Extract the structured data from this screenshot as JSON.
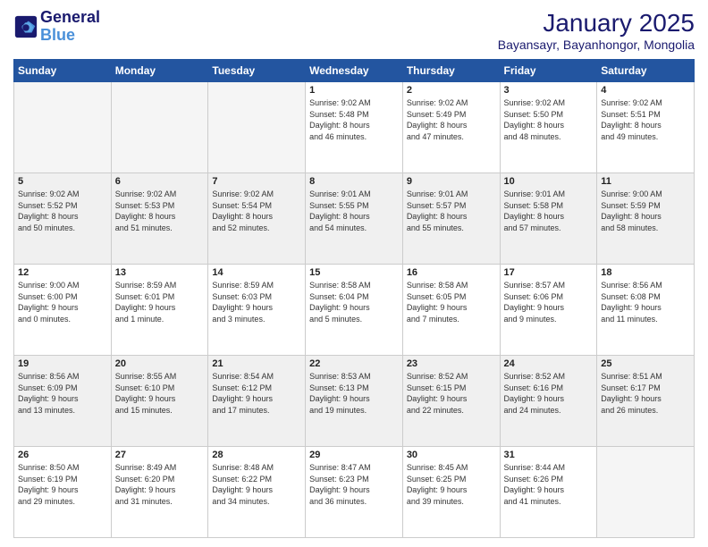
{
  "header": {
    "logo_line1": "General",
    "logo_line2": "Blue",
    "month": "January 2025",
    "location": "Bayansayr, Bayanhongor, Mongolia"
  },
  "weekdays": [
    "Sunday",
    "Monday",
    "Tuesday",
    "Wednesday",
    "Thursday",
    "Friday",
    "Saturday"
  ],
  "weeks": [
    [
      {
        "day": "",
        "info": ""
      },
      {
        "day": "",
        "info": ""
      },
      {
        "day": "",
        "info": ""
      },
      {
        "day": "1",
        "info": "Sunrise: 9:02 AM\nSunset: 5:48 PM\nDaylight: 8 hours\nand 46 minutes."
      },
      {
        "day": "2",
        "info": "Sunrise: 9:02 AM\nSunset: 5:49 PM\nDaylight: 8 hours\nand 47 minutes."
      },
      {
        "day": "3",
        "info": "Sunrise: 9:02 AM\nSunset: 5:50 PM\nDaylight: 8 hours\nand 48 minutes."
      },
      {
        "day": "4",
        "info": "Sunrise: 9:02 AM\nSunset: 5:51 PM\nDaylight: 8 hours\nand 49 minutes."
      }
    ],
    [
      {
        "day": "5",
        "info": "Sunrise: 9:02 AM\nSunset: 5:52 PM\nDaylight: 8 hours\nand 50 minutes."
      },
      {
        "day": "6",
        "info": "Sunrise: 9:02 AM\nSunset: 5:53 PM\nDaylight: 8 hours\nand 51 minutes."
      },
      {
        "day": "7",
        "info": "Sunrise: 9:02 AM\nSunset: 5:54 PM\nDaylight: 8 hours\nand 52 minutes."
      },
      {
        "day": "8",
        "info": "Sunrise: 9:01 AM\nSunset: 5:55 PM\nDaylight: 8 hours\nand 54 minutes."
      },
      {
        "day": "9",
        "info": "Sunrise: 9:01 AM\nSunset: 5:57 PM\nDaylight: 8 hours\nand 55 minutes."
      },
      {
        "day": "10",
        "info": "Sunrise: 9:01 AM\nSunset: 5:58 PM\nDaylight: 8 hours\nand 57 minutes."
      },
      {
        "day": "11",
        "info": "Sunrise: 9:00 AM\nSunset: 5:59 PM\nDaylight: 8 hours\nand 58 minutes."
      }
    ],
    [
      {
        "day": "12",
        "info": "Sunrise: 9:00 AM\nSunset: 6:00 PM\nDaylight: 9 hours\nand 0 minutes."
      },
      {
        "day": "13",
        "info": "Sunrise: 8:59 AM\nSunset: 6:01 PM\nDaylight: 9 hours\nand 1 minute."
      },
      {
        "day": "14",
        "info": "Sunrise: 8:59 AM\nSunset: 6:03 PM\nDaylight: 9 hours\nand 3 minutes."
      },
      {
        "day": "15",
        "info": "Sunrise: 8:58 AM\nSunset: 6:04 PM\nDaylight: 9 hours\nand 5 minutes."
      },
      {
        "day": "16",
        "info": "Sunrise: 8:58 AM\nSunset: 6:05 PM\nDaylight: 9 hours\nand 7 minutes."
      },
      {
        "day": "17",
        "info": "Sunrise: 8:57 AM\nSunset: 6:06 PM\nDaylight: 9 hours\nand 9 minutes."
      },
      {
        "day": "18",
        "info": "Sunrise: 8:56 AM\nSunset: 6:08 PM\nDaylight: 9 hours\nand 11 minutes."
      }
    ],
    [
      {
        "day": "19",
        "info": "Sunrise: 8:56 AM\nSunset: 6:09 PM\nDaylight: 9 hours\nand 13 minutes."
      },
      {
        "day": "20",
        "info": "Sunrise: 8:55 AM\nSunset: 6:10 PM\nDaylight: 9 hours\nand 15 minutes."
      },
      {
        "day": "21",
        "info": "Sunrise: 8:54 AM\nSunset: 6:12 PM\nDaylight: 9 hours\nand 17 minutes."
      },
      {
        "day": "22",
        "info": "Sunrise: 8:53 AM\nSunset: 6:13 PM\nDaylight: 9 hours\nand 19 minutes."
      },
      {
        "day": "23",
        "info": "Sunrise: 8:52 AM\nSunset: 6:15 PM\nDaylight: 9 hours\nand 22 minutes."
      },
      {
        "day": "24",
        "info": "Sunrise: 8:52 AM\nSunset: 6:16 PM\nDaylight: 9 hours\nand 24 minutes."
      },
      {
        "day": "25",
        "info": "Sunrise: 8:51 AM\nSunset: 6:17 PM\nDaylight: 9 hours\nand 26 minutes."
      }
    ],
    [
      {
        "day": "26",
        "info": "Sunrise: 8:50 AM\nSunset: 6:19 PM\nDaylight: 9 hours\nand 29 minutes."
      },
      {
        "day": "27",
        "info": "Sunrise: 8:49 AM\nSunset: 6:20 PM\nDaylight: 9 hours\nand 31 minutes."
      },
      {
        "day": "28",
        "info": "Sunrise: 8:48 AM\nSunset: 6:22 PM\nDaylight: 9 hours\nand 34 minutes."
      },
      {
        "day": "29",
        "info": "Sunrise: 8:47 AM\nSunset: 6:23 PM\nDaylight: 9 hours\nand 36 minutes."
      },
      {
        "day": "30",
        "info": "Sunrise: 8:45 AM\nSunset: 6:25 PM\nDaylight: 9 hours\nand 39 minutes."
      },
      {
        "day": "31",
        "info": "Sunrise: 8:44 AM\nSunset: 6:26 PM\nDaylight: 9 hours\nand 41 minutes."
      },
      {
        "day": "",
        "info": ""
      }
    ]
  ]
}
